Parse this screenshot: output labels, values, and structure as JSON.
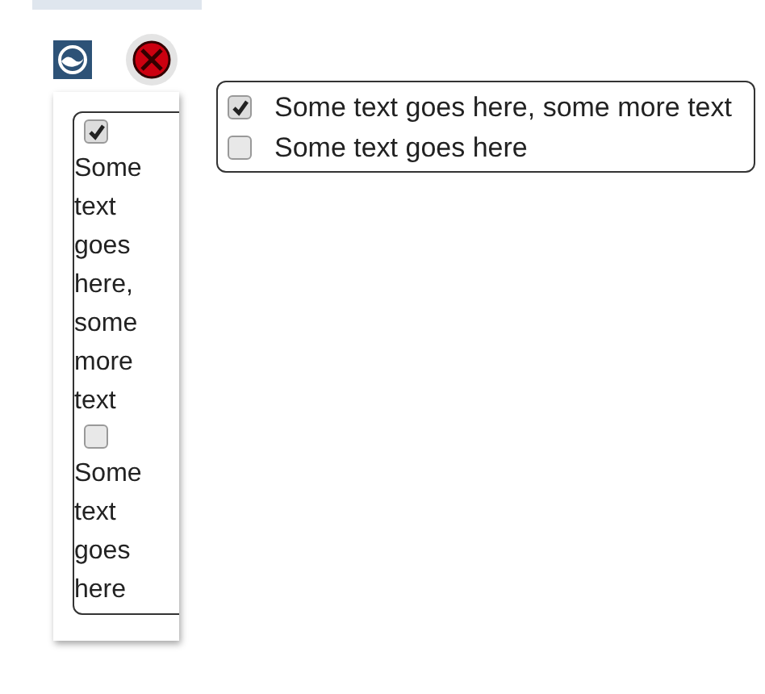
{
  "popup": {
    "items": [
      {
        "label": "Some text goes here, some more text",
        "checked": true
      },
      {
        "label": "Some text goes here",
        "checked": false
      }
    ]
  },
  "panel": {
    "items": [
      {
        "label": "Some text goes here, some more text",
        "checked": true
      },
      {
        "label": "Some text goes here",
        "checked": false
      }
    ]
  }
}
